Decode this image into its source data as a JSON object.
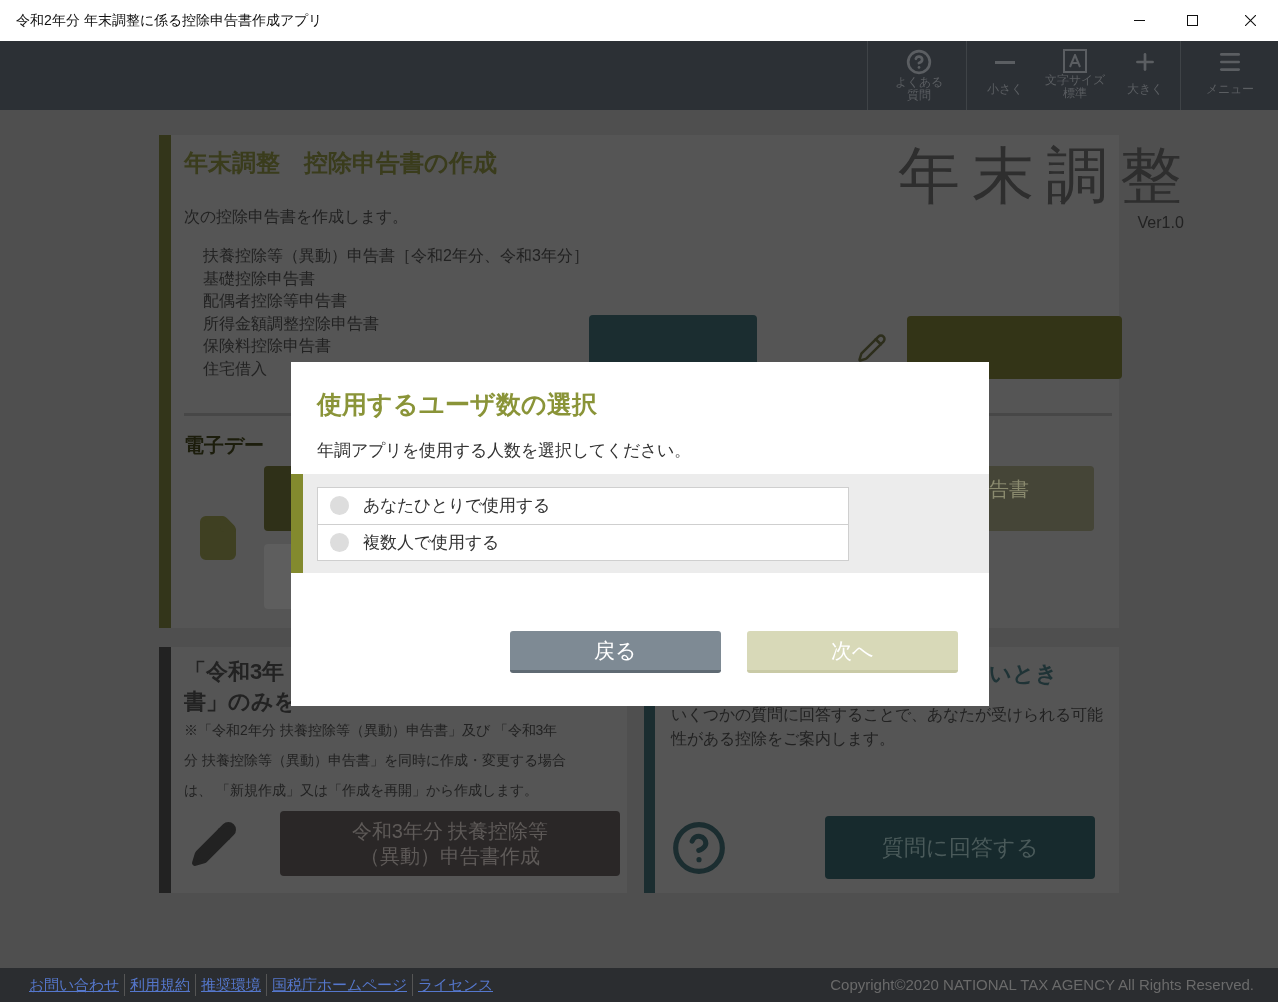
{
  "window": {
    "title": "令和2年分 年末調整に係る控除申告書作成アプリ"
  },
  "toolbar": {
    "items": [
      {
        "kind": "help",
        "lines": [
          "よくある",
          "質問"
        ]
      },
      {
        "kind": "smaller",
        "lines": [
          "小さく"
        ]
      },
      {
        "kind": "standard",
        "lines": [
          "文字サイズ",
          "標準"
        ]
      },
      {
        "kind": "larger",
        "lines": [
          "大きく"
        ]
      },
      {
        "kind": "menu",
        "lines": [
          "メニュー"
        ]
      }
    ]
  },
  "main_card": {
    "title": "年末調整　控除申告書の作成",
    "logo": "年末調整",
    "version": "Ver1.0",
    "intro": "次の控除申告書を作成します。",
    "forms": [
      "扶養控除等（異動）申告書［令和2年分、令和3年分］",
      "基礎控除申告書",
      "配偶者控除等申告書",
      "所得金額調整控除申告書",
      "保険料控除申告書",
      "住宅借入"
    ],
    "section_title": "電子デー",
    "partial_button": "告書"
  },
  "notice_card": {
    "title_lines": [
      "「令和3年",
      "書」のみを"
    ],
    "note_lines": [
      "※「令和2年分 扶養控除等（異動）申告書」及び 「令和3年",
      "分 扶養控除等（異動）申告書」を同時に作成・変更する場合",
      "は、 「新規作成」又は「作成を再開」から作成します。"
    ],
    "button_lines": [
      "令和3年分 扶養控除等",
      "（異動）申告書作成"
    ]
  },
  "guide_card": {
    "title": "いとき",
    "body": "いくつかの質問に回答することで、あなたが受けられる可能性がある控除をご案内します。",
    "button": "質問に回答する"
  },
  "dialog": {
    "title": "使用するユーザ数の選択",
    "instruction": "年調アプリを使用する人数を選択してください。",
    "options": [
      {
        "label": "あなたひとりで使用する",
        "selected": false
      },
      {
        "label": "複数人で使用する",
        "selected": false
      }
    ],
    "buttons": [
      {
        "label": "戻る",
        "disabled": false
      },
      {
        "label": "次へ",
        "disabled": true
      }
    ]
  },
  "footer": {
    "links": [
      "お問い合わせ",
      "利用規約",
      "推奨環境",
      "国税庁ホームページ",
      "ライセンス"
    ],
    "copyright": "Copyright©2020 NATIONAL TAX AGENCY All Rights Reserved."
  }
}
